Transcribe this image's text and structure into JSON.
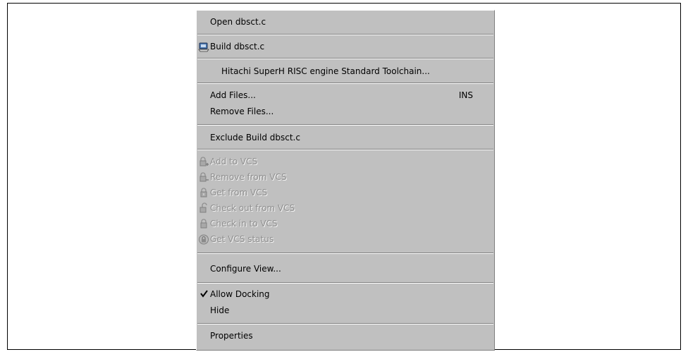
{
  "menu": {
    "open": "Open dbsct.c",
    "build": "Build dbsct.c",
    "toolchain": "Hitachi SuperH RISC engine Standard Toolchain...",
    "add_files": "Add Files...",
    "add_files_shortcut": "INS",
    "remove_files": "Remove Files...",
    "exclude_build": "Exclude Build dbsct.c",
    "add_vcs": "Add to VCS",
    "remove_vcs": "Remove from VCS",
    "get_vcs": "Get from VCS",
    "checkout_vcs": "Check out from VCS",
    "checkin_vcs": "Check in to VCS",
    "status_vcs": "Get VCS status",
    "configure_view": "Configure View...",
    "allow_docking": "Allow Docking",
    "hide": "Hide",
    "properties": "Properties"
  },
  "state": {
    "allow_docking_checked": true
  },
  "icons": {
    "build": "build-icon",
    "add_vcs": "vcs-add-icon",
    "remove_vcs": "vcs-remove-icon",
    "get_vcs": "vcs-get-icon",
    "checkout_vcs": "vcs-checkout-icon",
    "checkin_vcs": "vcs-checkin-icon",
    "status_vcs": "vcs-status-icon",
    "check": "checkmark-icon"
  }
}
